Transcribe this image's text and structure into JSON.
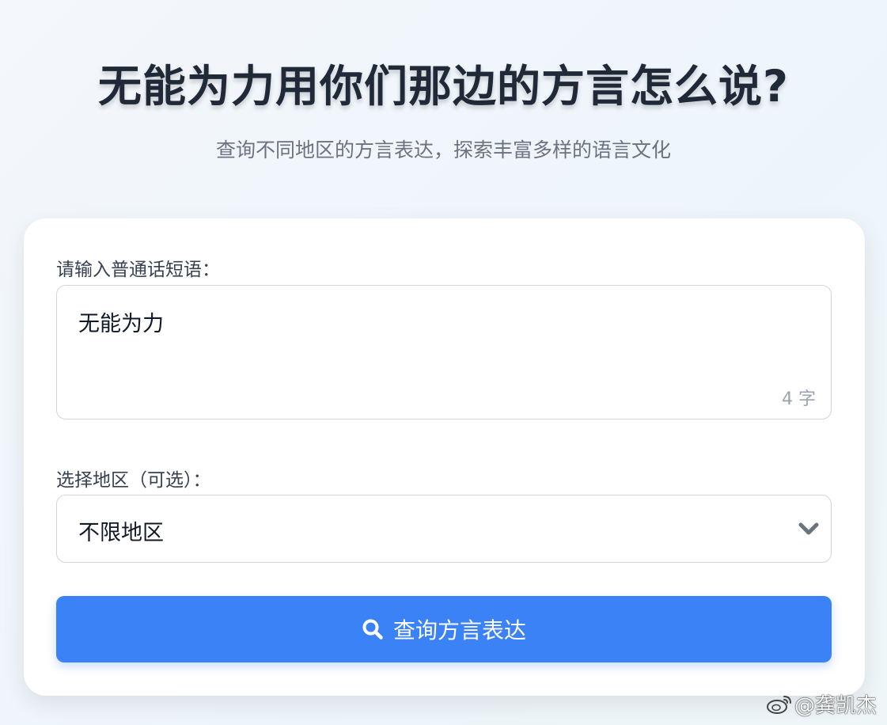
{
  "header": {
    "title": "无能为力用你们那边的方言怎么说?",
    "subtitle": "查询不同地区的方言表达，探索丰富多样的语言文化"
  },
  "form": {
    "phrase_label": "请输入普通话短语：",
    "phrase_value": "无能为力",
    "char_count": "4 字",
    "region_label": "选择地区（可选）：",
    "region_selected": "不限地区",
    "submit_label": "查询方言表达"
  },
  "icons": {
    "search": "search-icon",
    "dropdown": "chevron-down-icon",
    "watermark": "weibo-icon"
  },
  "watermark": {
    "text": "@龚凯杰"
  },
  "colors": {
    "accent": "#3b82f6",
    "title": "#1f2937",
    "subtitle": "#6b7280",
    "muted": "#9ca3af",
    "border": "#d1d5db"
  }
}
